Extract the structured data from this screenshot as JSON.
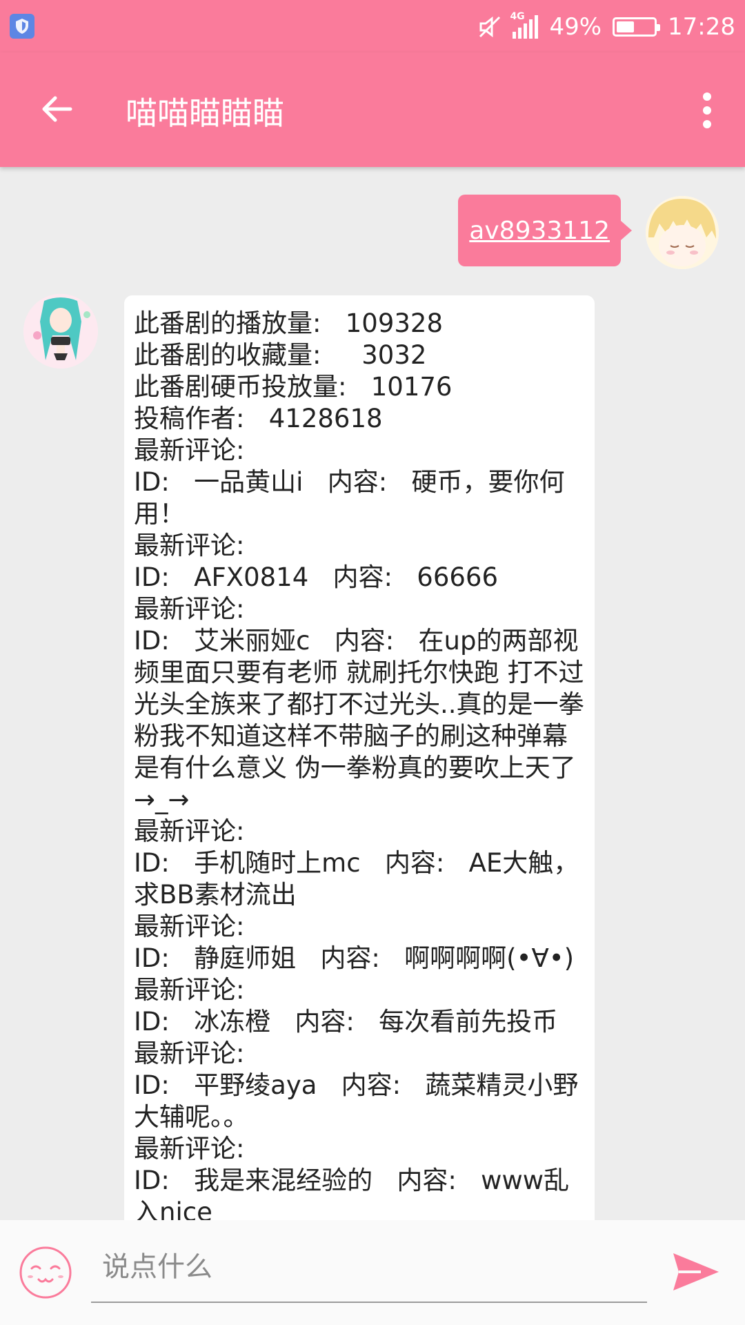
{
  "status_bar": {
    "network": "4G",
    "battery": "49%",
    "battery_level": 0.49,
    "time": "17:28"
  },
  "app_bar": {
    "title": "喵喵瞄瞄瞄"
  },
  "messages": {
    "outgoing_text": "av8933112",
    "incoming_lines": [
      "此番剧的播放量:   109328",
      "此番剧的收藏量:     3032",
      "此番剧硬币投放量:   10176",
      "投稿作者:   4128618",
      "最新评论:",
      "ID:   一品黄山i   内容:   硬币，要你何用！",
      "最新评论:",
      "ID:   AFX0814   内容:   66666",
      "最新评论:",
      "ID:   艾米丽娅c   内容:   在up的两部视频里面只要有老师 就刷托尔快跑 打不过光头全族来了都打不过光头..真的是一拳粉我不知道这样不带脑子的刷这种弹幕是有什么意义 伪一拳粉真的要吹上天了→_→",
      "最新评论:",
      "ID:   手机随时上mc   内容:   AE大触，求BB素材流出",
      "最新评论:",
      "ID:   静庭师姐   内容:   啊啊啊啊(•∀•)",
      "最新评论:",
      "ID:   冰冻橙   内容:   每次看前先投币",
      "最新评论:",
      "ID:   平野绫aya   内容:   蔬菜精灵小野大辅呢。。",
      "最新评论:",
      "ID:   我是来混经验的   内容:   www乱入nice"
    ]
  },
  "input": {
    "placeholder": "说点什么",
    "value": ""
  },
  "colors": {
    "accent": "#fa7b9b",
    "background": "#ededed"
  },
  "icons": {
    "back": "arrow-left-icon",
    "more": "more-vert-icon",
    "emoji": "smiley-face-icon",
    "send": "send-icon"
  }
}
